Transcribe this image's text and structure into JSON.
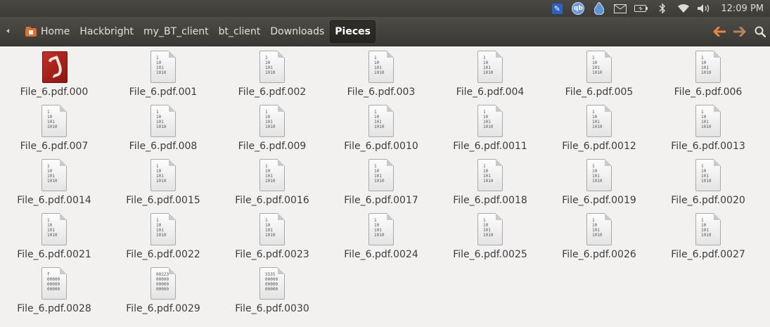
{
  "panel": {
    "clock": "12:09 PM",
    "tray_icons": [
      "text-entry-icon",
      "qbittorrent-icon",
      "dropbox-icon",
      "mail-icon",
      "battery-icon",
      "bluetooth-icon",
      "wifi-icon",
      "volume-icon"
    ],
    "qb_label": "qb"
  },
  "toolbar": {
    "breadcrumbs": [
      "Home",
      "Hackbright",
      "my_BT_client",
      "bt_client",
      "Downloads",
      "Pieces"
    ],
    "active_crumb": "Pieces",
    "back_glyph": "🡐",
    "forward_glyph": "🡒",
    "search_glyph": "🔍"
  },
  "files": [
    {
      "name": "File_6.pdf.000",
      "icon": "pdf-icon",
      "preview": ""
    },
    {
      "name": "File_6.pdf.001",
      "icon": "binary-file-icon",
      "preview": "1\n10\n101\n1010"
    },
    {
      "name": "File_6.pdf.002",
      "icon": "binary-file-icon",
      "preview": "1\n10\n101\n1010"
    },
    {
      "name": "File_6.pdf.003",
      "icon": "binary-file-icon",
      "preview": "1\n10\n101\n1010"
    },
    {
      "name": "File_6.pdf.004",
      "icon": "binary-file-icon",
      "preview": "1\n10\n101\n1010"
    },
    {
      "name": "File_6.pdf.005",
      "icon": "binary-file-icon",
      "preview": "1\n10\n101\n1010"
    },
    {
      "name": "File_6.pdf.006",
      "icon": "binary-file-icon",
      "preview": "1\n10\n101\n1010"
    },
    {
      "name": "File_6.pdf.007",
      "icon": "binary-file-icon",
      "preview": "1\n10\n101\n1010"
    },
    {
      "name": "File_6.pdf.008",
      "icon": "binary-file-icon",
      "preview": "1\n10\n101\n1010"
    },
    {
      "name": "File_6.pdf.009",
      "icon": "binary-file-icon",
      "preview": "1\n10\n101\n1010"
    },
    {
      "name": "File_6.pdf.0010",
      "icon": "binary-file-icon",
      "preview": "1\n10\n101\n1010"
    },
    {
      "name": "File_6.pdf.0011",
      "icon": "binary-file-icon",
      "preview": "1\n10\n101\n1010"
    },
    {
      "name": "File_6.pdf.0012",
      "icon": "binary-file-icon",
      "preview": "1\n10\n101\n1010"
    },
    {
      "name": "File_6.pdf.0013",
      "icon": "binary-file-icon",
      "preview": "1\n10\n101\n1010"
    },
    {
      "name": "File_6.pdf.0014",
      "icon": "binary-file-icon",
      "preview": "1\n10\n101\n1010"
    },
    {
      "name": "File_6.pdf.0015",
      "icon": "binary-file-icon",
      "preview": "1\n10\n101\n1010"
    },
    {
      "name": "File_6.pdf.0016",
      "icon": "binary-file-icon",
      "preview": "1\n10\n101\n1010"
    },
    {
      "name": "File_6.pdf.0017",
      "icon": "binary-file-icon",
      "preview": "1\n10\n101\n1010"
    },
    {
      "name": "File_6.pdf.0018",
      "icon": "binary-file-icon",
      "preview": "1\n10\n101\n1010"
    },
    {
      "name": "File_6.pdf.0019",
      "icon": "binary-file-icon",
      "preview": "1\n10\n101\n1010"
    },
    {
      "name": "File_6.pdf.0020",
      "icon": "binary-file-icon",
      "preview": "1\n10\n101\n1010"
    },
    {
      "name": "File_6.pdf.0021",
      "icon": "binary-file-icon",
      "preview": "1\n10\n101\n1010"
    },
    {
      "name": "File_6.pdf.0022",
      "icon": "binary-file-icon",
      "preview": "1\n10\n101\n1010"
    },
    {
      "name": "File_6.pdf.0023",
      "icon": "binary-file-icon",
      "preview": "1\n10\n101\n1010"
    },
    {
      "name": "File_6.pdf.0024",
      "icon": "binary-file-icon",
      "preview": "1\n10\n101\n1010"
    },
    {
      "name": "File_6.pdf.0025",
      "icon": "binary-file-icon",
      "preview": "1\n10\n101\n1010"
    },
    {
      "name": "File_6.pdf.0026",
      "icon": "binary-file-icon",
      "preview": "1\n10\n101\n1010"
    },
    {
      "name": "File_6.pdf.0027",
      "icon": "binary-file-icon",
      "preview": "1\n10\n101\n1010"
    },
    {
      "name": "File_6.pdf.0028",
      "icon": "text-file-icon",
      "preview": "f\n00000\n00000\n00000"
    },
    {
      "name": "File_6.pdf.0029",
      "icon": "text-file-icon",
      "preview": "00223\n00000\n00000\n00000"
    },
    {
      "name": "File_6.pdf.0030",
      "icon": "text-file-icon",
      "preview": "5535\n00000\n00000\n00000"
    }
  ]
}
